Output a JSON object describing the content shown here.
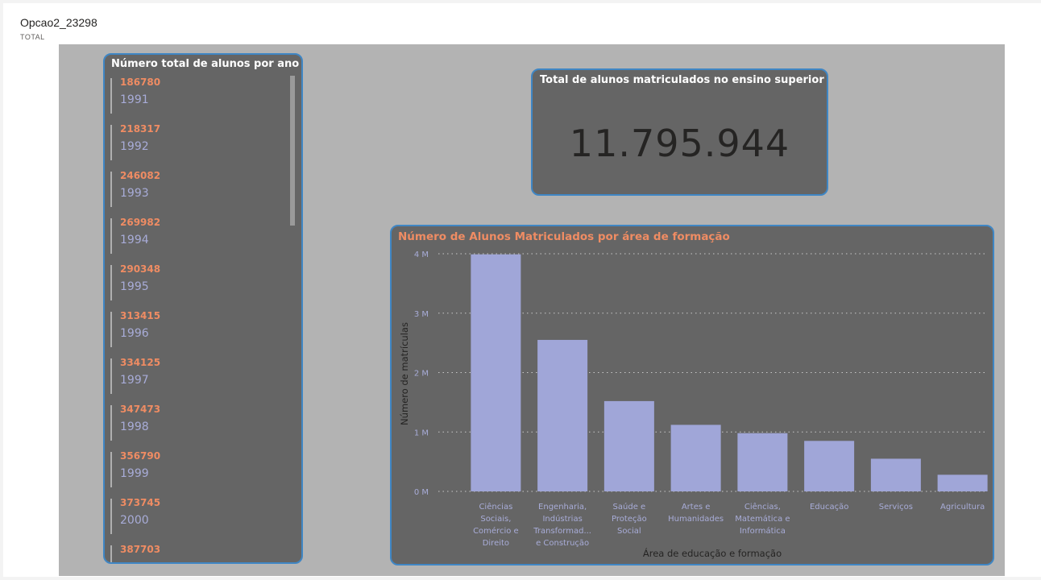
{
  "report": {
    "title": "Opcao2_23298",
    "subtitle": "TOTAL"
  },
  "year_list": {
    "title": "Número total de alunos por ano",
    "items": [
      {
        "value": "186780",
        "year": "1991"
      },
      {
        "value": "218317",
        "year": "1992"
      },
      {
        "value": "246082",
        "year": "1993"
      },
      {
        "value": "269982",
        "year": "1994"
      },
      {
        "value": "290348",
        "year": "1995"
      },
      {
        "value": "313415",
        "year": "1996"
      },
      {
        "value": "334125",
        "year": "1997"
      },
      {
        "value": "347473",
        "year": "1998"
      },
      {
        "value": "356790",
        "year": "1999"
      },
      {
        "value": "373745",
        "year": "2000"
      },
      {
        "value": "387703",
        "year": ""
      }
    ]
  },
  "kpi": {
    "title": "Total de alunos matriculados no ensino superior",
    "value": "11.795.944"
  },
  "chart_data": {
    "type": "bar",
    "title": "Número de Alunos Matriculados por área de formação",
    "xlabel": "Área de educação e formação",
    "ylabel": "Número de matrículas",
    "categories": [
      [
        "Ciências",
        "Sociais,",
        "Comércio e",
        "Direito"
      ],
      [
        "Engenharia,",
        "Indústrias",
        "Transformad...",
        "e Construção"
      ],
      [
        "Saúde e",
        "Proteção",
        "Social"
      ],
      [
        "Artes e",
        "Humanidades"
      ],
      [
        "Ciências,",
        "Matemática e",
        "Informática"
      ],
      [
        "Educação"
      ],
      [
        "Serviços"
      ],
      [
        "Agricultura"
      ]
    ],
    "values": [
      3990000,
      2550000,
      1520000,
      1120000,
      980000,
      850000,
      550000,
      280000
    ],
    "ylim": [
      0,
      4000000
    ],
    "yticks": [
      0,
      1000000,
      2000000,
      3000000,
      4000000
    ],
    "ytick_labels": [
      "0 M",
      "1 M",
      "2 M",
      "3 M",
      "4 M"
    ],
    "grid": true,
    "bar_color": "#a0a6d8",
    "title_color": "#ef8c63"
  },
  "colors": {
    "accent_value": "#ef8c63",
    "year_text": "#a8acd8",
    "card_border": "#3f86c4",
    "card_bg": "#656565",
    "canvas_bg": "#b3b3b3"
  }
}
